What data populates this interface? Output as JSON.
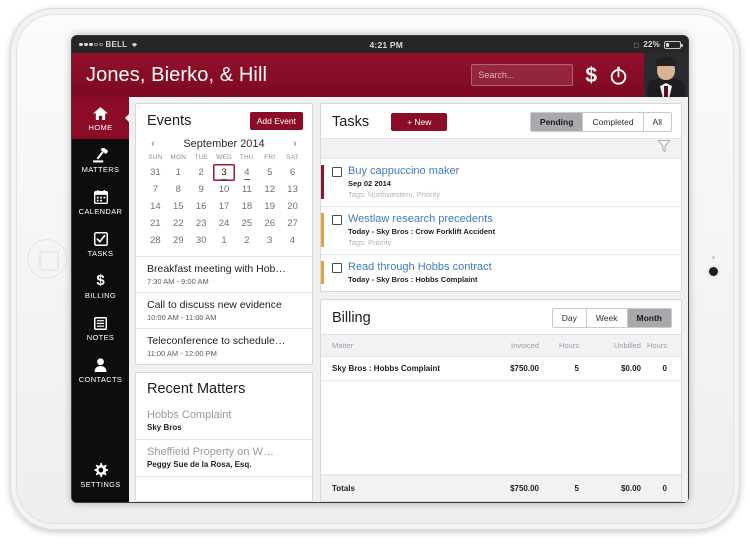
{
  "status_bar": {
    "carrier": "BELL",
    "signal_dots_filled": 3,
    "signal_dots_empty": 2,
    "wifi_icon": "wifi-icon",
    "time": "4:21 PM",
    "lock_icon": "orientation-lock-icon",
    "battery_percent": "22%",
    "battery_icon": "battery-icon"
  },
  "header": {
    "firm_title": "Jones, Bierko, & Hill",
    "search_placeholder": "Search...",
    "search_value": "",
    "billing_icon": "dollar-icon",
    "timer_icon": "stopwatch-icon",
    "avatar": "user-avatar",
    "accent_color": "#8b0c27"
  },
  "sidebar": {
    "items": [
      {
        "label": "HOME",
        "icon": "home-icon",
        "active": true
      },
      {
        "label": "MATTERS",
        "icon": "gavel-icon",
        "active": false
      },
      {
        "label": "CALENDAR",
        "icon": "calendar-icon",
        "active": false
      },
      {
        "label": "TASKS",
        "icon": "checkbox-icon",
        "active": false
      },
      {
        "label": "BILLING",
        "icon": "dollar-icon",
        "active": false
      },
      {
        "label": "NOTES",
        "icon": "notes-icon",
        "active": false
      },
      {
        "label": "CONTACTS",
        "icon": "person-icon",
        "active": false
      }
    ],
    "settings": {
      "label": "SETTINGS",
      "icon": "gear-icon"
    }
  },
  "events_card": {
    "title": "Events",
    "add_button": "Add Event",
    "calendar": {
      "prev_icon": "chevron-left-icon",
      "next_icon": "chevron-right-icon",
      "month_label": "September 2014",
      "day_headers": [
        "SUN",
        "MON",
        "TUE",
        "WED",
        "THU",
        "FRI",
        "SAT"
      ],
      "weeks": [
        [
          "31",
          "1",
          "2",
          "3",
          "4",
          "5",
          "6"
        ],
        [
          "7",
          "8",
          "9",
          "10",
          "11",
          "12",
          "13"
        ],
        [
          "14",
          "15",
          "16",
          "17",
          "18",
          "19",
          "20"
        ],
        [
          "21",
          "22",
          "23",
          "24",
          "25",
          "26",
          "27"
        ],
        [
          "28",
          "29",
          "30",
          "1",
          "2",
          "3",
          "4"
        ]
      ],
      "selected": "3",
      "underlined": "4"
    },
    "events": [
      {
        "title": "Breakfast meeting with Hob…",
        "time": "7:30 AM - 9:00 AM"
      },
      {
        "title": "Call to discuss new evidence",
        "time": "10:00 AM - 11:00 AM"
      },
      {
        "title": "Teleconference to schedule…",
        "time": "11:00 AM - 12:00 PM"
      }
    ]
  },
  "matters_card": {
    "title": "Recent Matters",
    "matters": [
      {
        "name": "Hobbs Complaint",
        "client": "Sky Bros"
      },
      {
        "name": "Sheffield Property on W…",
        "client": "Peggy Sue de la Rosa, Esq."
      }
    ]
  },
  "tasks_card": {
    "title": "Tasks",
    "new_button": "+ New",
    "filters": [
      {
        "label": "Pending",
        "on": true
      },
      {
        "label": "Completed",
        "on": false
      },
      {
        "label": "All",
        "on": false
      }
    ],
    "filter_icon": "funnel-filter-icon",
    "tasks": [
      {
        "title": "Buy cappuccino maker",
        "subtitle": "Sep 02 2014",
        "tags": "Tags: Northwestern, Priority",
        "accent_color": "#8b1a2b",
        "checked": false
      },
      {
        "title": "Westlaw research precedents",
        "subtitle": "Today - Sky Bros : Crow Forklift Accident",
        "tags": "Tags: Priority",
        "accent_color": "#e2a33c",
        "checked": false
      },
      {
        "title": "Read through Hobbs contract",
        "subtitle": "Today - Sky Bros : Hobbs Complaint",
        "tags": "",
        "accent_color": "#e2a33c",
        "checked": false
      }
    ]
  },
  "billing_card": {
    "title": "Billing",
    "ranges": [
      {
        "label": "Day",
        "on": false
      },
      {
        "label": "Week",
        "on": false
      },
      {
        "label": "Month",
        "on": true
      }
    ],
    "columns": [
      "Matter",
      "Invoiced",
      "Hours",
      "Unbilled",
      "Hours"
    ],
    "rows": [
      {
        "matter": "Sky Bros : Hobbs Complaint",
        "invoiced": "$750.00",
        "hours": "5",
        "unbilled": "$0.00",
        "unbilled_hours": "0"
      }
    ],
    "totals": {
      "label": "Totals",
      "invoiced": "$750.00",
      "hours": "5",
      "unbilled": "$0.00",
      "unbilled_hours": "0"
    }
  }
}
